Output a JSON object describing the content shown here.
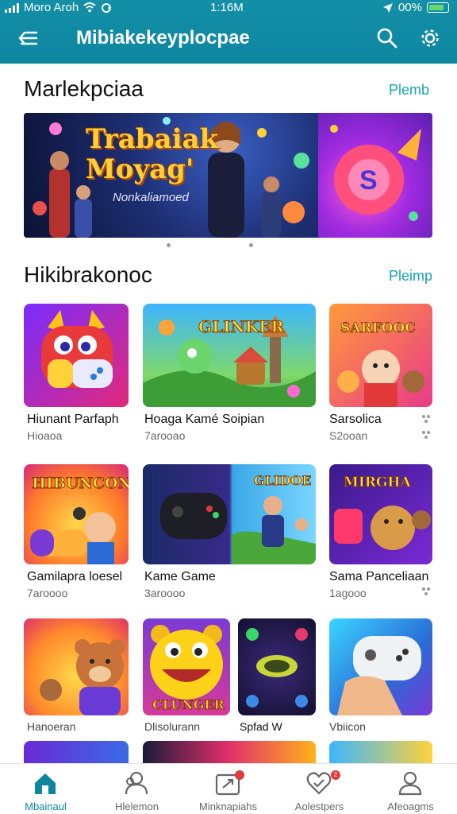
{
  "status_bar": {
    "carrier": "Moro Aroh",
    "time": "1:16M",
    "battery": "00%"
  },
  "app_bar": {
    "title": "Mibiakekeyplocpae",
    "icons": [
      "menu-icon",
      "search-icon",
      "gear-icon"
    ]
  },
  "featured": {
    "title": "Marlekpciaa",
    "link": "Plemb",
    "banner_title_1": "Trabaiak",
    "banner_title_2": "Moyag'",
    "banner_subtitle": "Nonkaliamoed",
    "pages": 2,
    "active_page": 1
  },
  "popular": {
    "title": "Hikibrakonoc",
    "link": "Pleimp",
    "rows": [
      [
        {
          "name": "Hiunant Parfaph",
          "sub": "Hioaoa",
          "art": "Monster controller"
        },
        {
          "name": "Hoaga Kamé Soipian",
          "sub": "7arooao",
          "art": "Glinker Rabaiis"
        },
        {
          "name": "Sarsolica",
          "sub": "S2ooan",
          "art": "Sarfooc Homor!"
        }
      ],
      [
        {
          "name": "Gamilapra loesel",
          "sub": "7aroooo",
          "art": "Hibuncon"
        },
        {
          "name": "Kame Game",
          "sub": "3aroooo",
          "art": "Glidoe Sanvies"
        },
        {
          "name": "Sama Panceliaan",
          "sub": "1agooo",
          "art": "Mirgha Chandes!"
        }
      ],
      [
        {
          "name": "Hanoeran",
          "sub": "",
          "art": "Bear"
        },
        {
          "name": "Dlisolurann",
          "sub": "",
          "art": "Clunger"
        },
        {
          "name": "Spfad W",
          "sub": "",
          "art": ""
        },
        {
          "name": "Vbiicon",
          "sub": "",
          "art": ""
        }
      ]
    ]
  },
  "bottom_nav": {
    "items": [
      {
        "label": "Mbainaul",
        "icon": "home-icon",
        "active": true
      },
      {
        "label": "Hlelemon",
        "icon": "users-icon",
        "active": false
      },
      {
        "label": "Minknapiahs",
        "icon": "messages-icon",
        "active": false
      },
      {
        "label": "Aolestpers",
        "icon": "heart-check-icon",
        "active": false,
        "badge": "2"
      },
      {
        "label": "Afeoagms",
        "icon": "profile-icon",
        "active": false
      }
    ]
  },
  "colors": {
    "accent": "#0f86a0",
    "link": "#15a2b9",
    "badge": "#e23b3b"
  }
}
